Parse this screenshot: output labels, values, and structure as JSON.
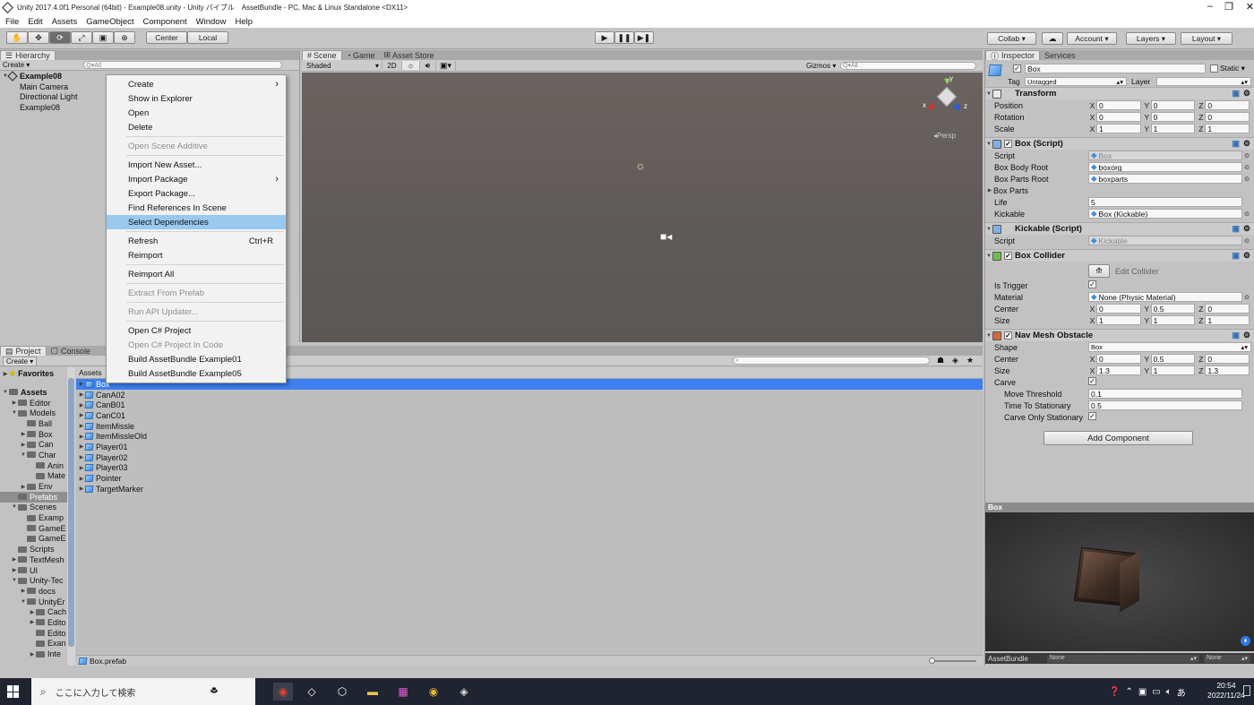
{
  "window": {
    "title": "Unity 2017.4.0f1 Personal (64bit) - Example08.unity - Unity パイプル　AssetBundle - PC, Mac & Linux Standalone <DX11>",
    "controls": [
      "–",
      "❐",
      "✕"
    ]
  },
  "menubar": [
    "File",
    "Edit",
    "Assets",
    "GameObject",
    "Component",
    "Window",
    "Help"
  ],
  "toolbar": {
    "pivot": "Center",
    "space": "Local",
    "collab": "Collab ▾",
    "account": "Account",
    "layers": "Layers",
    "layout": "Layout"
  },
  "hierarchy": {
    "tab": "Hierarchy",
    "create": "Create",
    "search_placeholder": "Q▾All",
    "scene": "Example08",
    "items": [
      "Main Camera",
      "Directional Light",
      "Example08"
    ]
  },
  "scene_view": {
    "tabs": [
      "Scene",
      "Game",
      "Asset Store"
    ],
    "shading": "Shaded",
    "mode2d": "2D",
    "gizmos": "Gizmos",
    "search_placeholder": "Q▾All",
    "persp": "Persp",
    "gizmo_axes": [
      "x",
      "y",
      "z"
    ]
  },
  "context_menu": {
    "items": [
      {
        "label": "Create",
        "submenu": true
      },
      {
        "label": "Show in Explorer"
      },
      {
        "label": "Open"
      },
      {
        "label": "Delete"
      },
      {
        "sep": true
      },
      {
        "label": "Open Scene Additive",
        "disabled": true
      },
      {
        "sep": true
      },
      {
        "label": "Import New Asset..."
      },
      {
        "label": "Import Package",
        "submenu": true
      },
      {
        "label": "Export Package..."
      },
      {
        "label": "Find References In Scene"
      },
      {
        "label": "Select Dependencies",
        "selected": true
      },
      {
        "sep": true
      },
      {
        "label": "Refresh",
        "shortcut": "Ctrl+R"
      },
      {
        "label": "Reimport"
      },
      {
        "sep": true
      },
      {
        "label": "Reimport All"
      },
      {
        "sep": true
      },
      {
        "label": "Extract From Prefab",
        "disabled": true
      },
      {
        "sep": true
      },
      {
        "label": "Run API Updater...",
        "disabled": true
      },
      {
        "sep": true
      },
      {
        "label": "Open C# Project"
      },
      {
        "label": "Open C# Project In Code",
        "disabled": true
      },
      {
        "label": "Build AssetBundle Example01"
      },
      {
        "label": "Build AssetBundle Example05"
      }
    ]
  },
  "project": {
    "tabs": [
      "Project",
      "Console"
    ],
    "create": "Create",
    "favorites": "Favorites",
    "tree": [
      {
        "label": "Assets",
        "depth": 0,
        "open": true,
        "bold": true
      },
      {
        "label": "Editor",
        "depth": 1,
        "open": false
      },
      {
        "label": "Models",
        "depth": 1,
        "open": true
      },
      {
        "label": "Ball",
        "depth": 2,
        "leaf": true
      },
      {
        "label": "Box",
        "depth": 2,
        "open": false
      },
      {
        "label": "Can",
        "depth": 2,
        "open": false
      },
      {
        "label": "Char",
        "depth": 2,
        "open": true
      },
      {
        "label": "Anin",
        "depth": 3,
        "leaf": true
      },
      {
        "label": "Mate",
        "depth": 3,
        "leaf": true
      },
      {
        "label": "Env",
        "depth": 2,
        "open": false
      },
      {
        "label": "Prefabs",
        "depth": 1,
        "leaf": true,
        "selected": true
      },
      {
        "label": "Scenes",
        "depth": 1,
        "open": true
      },
      {
        "label": "Examp",
        "depth": 2,
        "leaf": true
      },
      {
        "label": "GameE",
        "depth": 2,
        "leaf": true
      },
      {
        "label": "GameE",
        "depth": 2,
        "leaf": true
      },
      {
        "label": "Scripts",
        "depth": 1,
        "leaf": true
      },
      {
        "label": "TextMesh",
        "depth": 1,
        "open": false
      },
      {
        "label": "UI",
        "depth": 1,
        "open": false
      },
      {
        "label": "Unity-Tec",
        "depth": 1,
        "open": true
      },
      {
        "label": "docs",
        "depth": 2,
        "open": false
      },
      {
        "label": "UnityEr",
        "depth": 2,
        "open": true
      },
      {
        "label": "Cach",
        "depth": 3,
        "open": false
      },
      {
        "label": "Edito",
        "depth": 3,
        "open": false
      },
      {
        "label": "Edito",
        "depth": 3,
        "leaf": true
      },
      {
        "label": "Exan",
        "depth": 3,
        "leaf": true
      },
      {
        "label": "Inte",
        "depth": 3,
        "open": false
      }
    ],
    "breadcrumb": "Assets",
    "assets": [
      "Box",
      "CanA02",
      "CanB01",
      "CanC01",
      "ItemMissle",
      "ItemMissleOld",
      "Player01",
      "Player02",
      "Player03",
      "Pointer",
      "TargetMarker"
    ],
    "selected_file": "Box.prefab"
  },
  "inspector": {
    "tabs": [
      "Inspector",
      "Services"
    ],
    "object_name": "Box",
    "static_label": "Static",
    "tag_label": "Tag",
    "tag_value": "Untagged",
    "layer_label": "Layer",
    "transform": {
      "title": "Transform",
      "position": {
        "label": "Position",
        "x": "0",
        "y": "0",
        "z": "0"
      },
      "rotation": {
        "label": "Rotation",
        "x": "0",
        "y": "0",
        "z": "0"
      },
      "scale": {
        "label": "Scale",
        "x": "1",
        "y": "1",
        "z": "1"
      }
    },
    "box_script": {
      "title": "Box (Script)",
      "script_label": "Script",
      "script_value": "Box",
      "body_root_label": "Box Body Root",
      "body_root_value": "boxorg",
      "parts_root_label": "Box Parts Root",
      "parts_root_value": "boxparts",
      "parts_label": "Box Parts",
      "life_label": "Life",
      "life_value": "5",
      "kickable_label": "Kickable",
      "kickable_value": "Box (Kickable)"
    },
    "kickable_script": {
      "title": "Kickable (Script)",
      "script_label": "Script",
      "script_value": "Kickable"
    },
    "box_collider": {
      "title": "Box Collider",
      "edit_label": "Edit Collider",
      "trigger_label": "Is Trigger",
      "material_label": "Material",
      "material_value": "None (Physic Material)",
      "center": {
        "label": "Center",
        "x": "0",
        "y": "0.5",
        "z": "0"
      },
      "size": {
        "label": "Size",
        "x": "1",
        "y": "1",
        "z": "1"
      }
    },
    "nav_mesh": {
      "title": "Nav Mesh Obstacle",
      "shape_label": "Shape",
      "shape_value": "Box",
      "center": {
        "label": "Center",
        "x": "0",
        "y": "0.5",
        "z": "0"
      },
      "size": {
        "label": "Size",
        "x": "1.3",
        "y": "1",
        "z": "1.3"
      },
      "carve_label": "Carve",
      "move_label": "Move Threshold",
      "move_value": "0.1",
      "time_label": "Time To Stationary",
      "time_value": "0.5",
      "carve_only_label": "Carve Only Stationary"
    },
    "add_component": "Add Component",
    "preview_title": "Box",
    "assetbundle_label": "AssetBundle",
    "assetbundle_value": "None",
    "assetbundle_variant": "None"
  },
  "taskbar": {
    "search_placeholder": "ここに入力して検索",
    "time": "20:54",
    "date": "2022/11/24"
  }
}
